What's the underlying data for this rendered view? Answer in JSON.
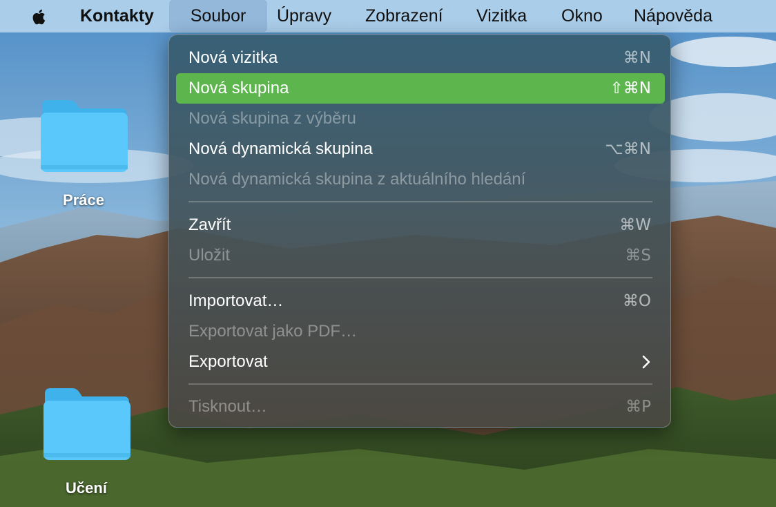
{
  "menubar": {
    "app_name": "Kontakty",
    "items": [
      "Soubor",
      "Úpravy",
      "Zobrazení",
      "Vizitka",
      "Okno",
      "Nápověda"
    ]
  },
  "desktop": {
    "folders": [
      {
        "label": "Práce"
      },
      {
        "label": "Učení"
      }
    ]
  },
  "menu": {
    "items": [
      {
        "label": "Nová vizitka",
        "shortcut": "⌘N",
        "enabled": true
      },
      {
        "label": "Nová skupina",
        "shortcut": "⇧⌘N",
        "enabled": true,
        "highlighted": true
      },
      {
        "label": "Nová skupina z výběru",
        "shortcut": "",
        "enabled": false
      },
      {
        "label": "Nová dynamická skupina",
        "shortcut": "⌥⌘N",
        "enabled": true
      },
      {
        "label": "Nová dynamická skupina z aktuálního hledání",
        "shortcut": "",
        "enabled": false
      },
      {
        "label": "Zavřít",
        "shortcut": "⌘W",
        "enabled": true
      },
      {
        "label": "Uložit",
        "shortcut": "⌘S",
        "enabled": false
      },
      {
        "label": "Importovat…",
        "shortcut": "⌘O",
        "enabled": true
      },
      {
        "label": "Exportovat jako PDF…",
        "shortcut": "",
        "enabled": false
      },
      {
        "label": "Exportovat",
        "shortcut": "",
        "enabled": true,
        "submenu": true
      },
      {
        "label": "Tisknout…",
        "shortcut": "⌘P",
        "enabled": false
      }
    ]
  },
  "colors": {
    "highlight": "#5db54e",
    "menubar": "#b2d2ec",
    "folder": "#5ac8fa"
  },
  "icons": {
    "apple": "apple-logo-icon",
    "folder": "folder-icon",
    "submenu": "chevron-right-icon"
  }
}
